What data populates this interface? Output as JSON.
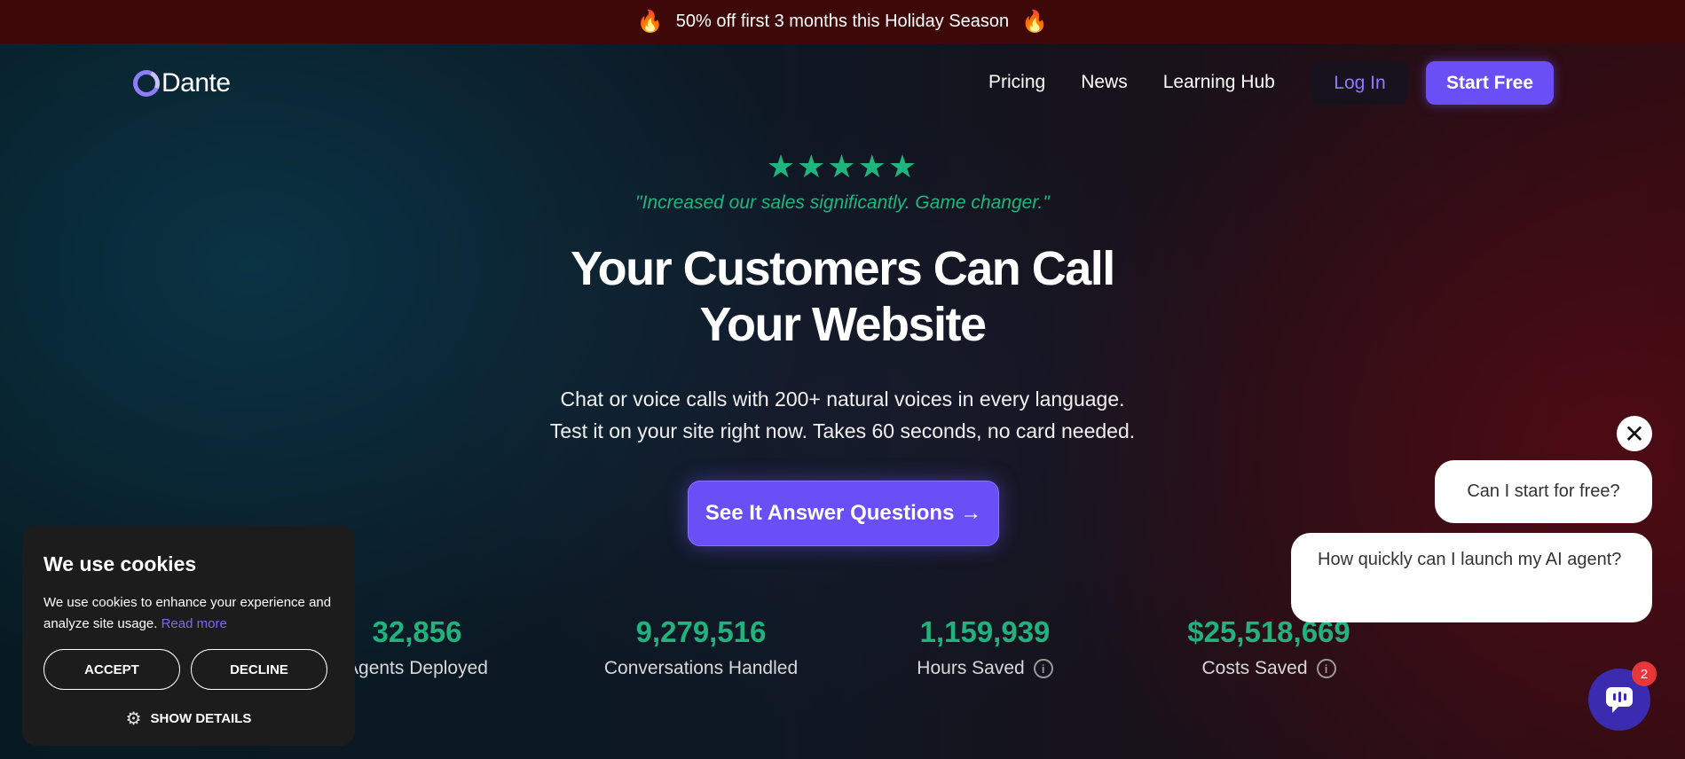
{
  "banner": {
    "text": "50% off first 3 months this Holiday Season",
    "left_icon": "fire-icon",
    "right_icon": "fire-icon"
  },
  "nav": {
    "logo_text": "Dante",
    "links": [
      "Pricing",
      "News",
      "Learning Hub"
    ],
    "login_label": "Log In",
    "start_label": "Start Free"
  },
  "hero": {
    "stars": "★★★★★",
    "rating": 5,
    "quote": "\"Increased our sales significantly. Game changer.\"",
    "headline_line1": "Your Customers Can Call",
    "headline_line2": "Your Website",
    "sub_line1": "Chat or voice calls with 200+ natural voices in every language.",
    "sub_line2": "Test it on your site right now. Takes 60 seconds, no card needed.",
    "cta_label": "See It Answer Questions →"
  },
  "stats": [
    {
      "value": "32,856",
      "label": "AI Agents Deployed",
      "visible_label": "Agents Deployed"
    },
    {
      "value": "9,279,516",
      "label": "Conversations Handled"
    },
    {
      "value": "1,159,939",
      "label": "Hours Saved",
      "info": "i"
    },
    {
      "value": "$25,518,669",
      "label": "Costs Saved",
      "info": "i"
    }
  ],
  "cookie": {
    "title": "We use cookies",
    "text": "We use cookies to enhance your experience and analyze site usage.",
    "read_more": "Read more",
    "accept": "ACCEPT",
    "decline": "DECLINE",
    "show_details": "SHOW DETAILS"
  },
  "chat": {
    "close": "✕",
    "suggestion1": "Can I start for free?",
    "suggestion2": "How quickly can I launch my AI agent?",
    "badge_count": "2"
  },
  "colors": {
    "accent": "#6a4ff6",
    "green": "#22b27d",
    "banner_bg": "#3e0808"
  }
}
